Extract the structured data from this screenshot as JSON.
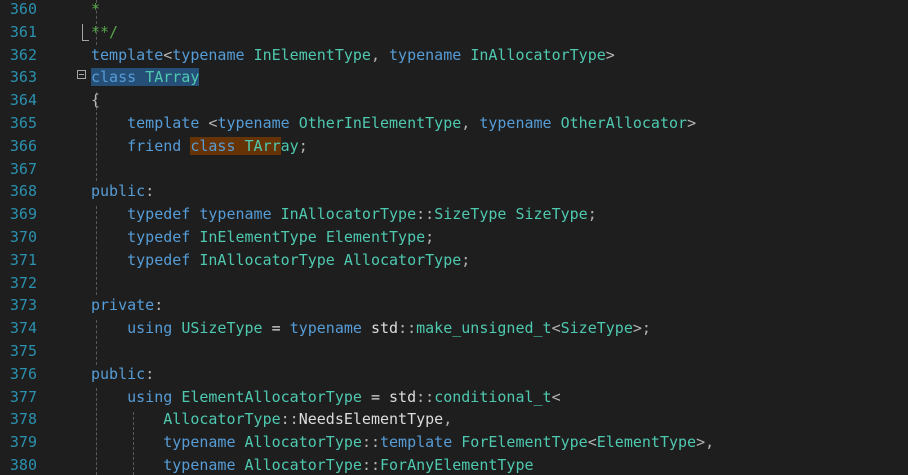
{
  "editor": {
    "lines": [
      {
        "number": "360",
        "tokens": [
          {
            "text": "*",
            "kind": "comment"
          }
        ]
      },
      {
        "number": "361",
        "tokens": [
          {
            "text": "**/",
            "kind": "comment"
          }
        ]
      },
      {
        "number": "362",
        "tokens": [
          {
            "text": "template",
            "kind": "kw"
          },
          {
            "text": "<",
            "kind": "punct"
          },
          {
            "text": "typename",
            "kind": "kw"
          },
          {
            "text": " ",
            "kind": "plain"
          },
          {
            "text": "InElementType",
            "kind": "type"
          },
          {
            "text": ", ",
            "kind": "punct"
          },
          {
            "text": "typename",
            "kind": "kw"
          },
          {
            "text": " ",
            "kind": "plain"
          },
          {
            "text": "InAllocatorType",
            "kind": "type"
          },
          {
            "text": ">",
            "kind": "punct"
          }
        ]
      },
      {
        "number": "363",
        "tokens": [
          {
            "text": "class",
            "kind": "kw",
            "hl": "sel"
          },
          {
            "text": " ",
            "kind": "plain",
            "hl": "sel"
          },
          {
            "text": "TArray",
            "kind": "type",
            "hl": "sel"
          }
        ]
      },
      {
        "number": "364",
        "tokens": [
          {
            "text": "{",
            "kind": "punct"
          }
        ]
      },
      {
        "number": "365",
        "tokens": [
          {
            "text": "    ",
            "kind": "plain"
          },
          {
            "text": "template",
            "kind": "kw"
          },
          {
            "text": " <",
            "kind": "punct"
          },
          {
            "text": "typename",
            "kind": "kw"
          },
          {
            "text": " ",
            "kind": "plain"
          },
          {
            "text": "OtherInElementType",
            "kind": "type"
          },
          {
            "text": ", ",
            "kind": "punct"
          },
          {
            "text": "typename",
            "kind": "kw"
          },
          {
            "text": " ",
            "kind": "plain"
          },
          {
            "text": "OtherAllocator",
            "kind": "type"
          },
          {
            "text": ">",
            "kind": "punct"
          }
        ]
      },
      {
        "number": "366",
        "tokens": [
          {
            "text": "    ",
            "kind": "plain"
          },
          {
            "text": "friend",
            "kind": "kw"
          },
          {
            "text": " ",
            "kind": "plain"
          },
          {
            "text": "class",
            "kind": "kw",
            "hl": "ref"
          },
          {
            "text": " ",
            "kind": "plain",
            "hl": "ref"
          },
          {
            "text": "TArr",
            "kind": "type",
            "hl": "ref"
          },
          {
            "text": "ay",
            "kind": "type"
          },
          {
            "text": ";",
            "kind": "punct"
          }
        ]
      },
      {
        "number": "367",
        "tokens": []
      },
      {
        "number": "368",
        "tokens": [
          {
            "text": "public",
            "kind": "kw"
          },
          {
            "text": ":",
            "kind": "punct"
          }
        ]
      },
      {
        "number": "369",
        "tokens": [
          {
            "text": "    ",
            "kind": "plain"
          },
          {
            "text": "typedef",
            "kind": "kw"
          },
          {
            "text": " ",
            "kind": "plain"
          },
          {
            "text": "typename",
            "kind": "kw"
          },
          {
            "text": " ",
            "kind": "plain"
          },
          {
            "text": "InAllocatorType",
            "kind": "type"
          },
          {
            "text": "::",
            "kind": "punct"
          },
          {
            "text": "SizeType",
            "kind": "type"
          },
          {
            "text": " ",
            "kind": "plain"
          },
          {
            "text": "SizeType",
            "kind": "type"
          },
          {
            "text": ";",
            "kind": "punct"
          }
        ]
      },
      {
        "number": "370",
        "tokens": [
          {
            "text": "    ",
            "kind": "plain"
          },
          {
            "text": "typedef",
            "kind": "kw"
          },
          {
            "text": " ",
            "kind": "plain"
          },
          {
            "text": "InElementType",
            "kind": "type"
          },
          {
            "text": " ",
            "kind": "plain"
          },
          {
            "text": "ElementType",
            "kind": "type"
          },
          {
            "text": ";",
            "kind": "punct"
          }
        ]
      },
      {
        "number": "371",
        "tokens": [
          {
            "text": "    ",
            "kind": "plain"
          },
          {
            "text": "typedef",
            "kind": "kw"
          },
          {
            "text": " ",
            "kind": "plain"
          },
          {
            "text": "InAllocatorType",
            "kind": "type"
          },
          {
            "text": " ",
            "kind": "plain"
          },
          {
            "text": "AllocatorType",
            "kind": "type"
          },
          {
            "text": ";",
            "kind": "punct"
          }
        ]
      },
      {
        "number": "372",
        "tokens": []
      },
      {
        "number": "373",
        "tokens": [
          {
            "text": "private",
            "kind": "kw"
          },
          {
            "text": ":",
            "kind": "punct"
          }
        ]
      },
      {
        "number": "374",
        "tokens": [
          {
            "text": "    ",
            "kind": "plain"
          },
          {
            "text": "using",
            "kind": "kw"
          },
          {
            "text": " ",
            "kind": "plain"
          },
          {
            "text": "USizeType",
            "kind": "type"
          },
          {
            "text": " = ",
            "kind": "plain"
          },
          {
            "text": "typename",
            "kind": "kw"
          },
          {
            "text": " std",
            "kind": "plain"
          },
          {
            "text": "::",
            "kind": "punct"
          },
          {
            "text": "make_unsigned_t",
            "kind": "type"
          },
          {
            "text": "<",
            "kind": "punct"
          },
          {
            "text": "SizeType",
            "kind": "type"
          },
          {
            "text": ">;",
            "kind": "punct"
          }
        ]
      },
      {
        "number": "375",
        "tokens": []
      },
      {
        "number": "376",
        "tokens": [
          {
            "text": "public",
            "kind": "kw"
          },
          {
            "text": ":",
            "kind": "punct"
          }
        ]
      },
      {
        "number": "377",
        "tokens": [
          {
            "text": "    ",
            "kind": "plain"
          },
          {
            "text": "using",
            "kind": "kw"
          },
          {
            "text": " ",
            "kind": "plain"
          },
          {
            "text": "ElementAllocatorType",
            "kind": "type"
          },
          {
            "text": " = ",
            "kind": "plain"
          },
          {
            "text": "std",
            "kind": "plain"
          },
          {
            "text": "::",
            "kind": "punct"
          },
          {
            "text": "conditional_t",
            "kind": "type"
          },
          {
            "text": "<",
            "kind": "punct"
          }
        ]
      },
      {
        "number": "378",
        "tokens": [
          {
            "text": "        ",
            "kind": "plain"
          },
          {
            "text": "AllocatorType",
            "kind": "type"
          },
          {
            "text": "::",
            "kind": "punct"
          },
          {
            "text": "NeedsElementType",
            "kind": "plain"
          },
          {
            "text": ",",
            "kind": "punct"
          }
        ]
      },
      {
        "number": "379",
        "tokens": [
          {
            "text": "        ",
            "kind": "plain"
          },
          {
            "text": "typename",
            "kind": "kw"
          },
          {
            "text": " ",
            "kind": "plain"
          },
          {
            "text": "AllocatorType",
            "kind": "type"
          },
          {
            "text": "::",
            "kind": "punct"
          },
          {
            "text": "template",
            "kind": "kw"
          },
          {
            "text": " ",
            "kind": "plain"
          },
          {
            "text": "ForElementType",
            "kind": "type"
          },
          {
            "text": "<",
            "kind": "punct"
          },
          {
            "text": "ElementType",
            "kind": "type"
          },
          {
            "text": ">,",
            "kind": "punct"
          }
        ]
      },
      {
        "number": "380",
        "tokens": [
          {
            "text": "        ",
            "kind": "plain"
          },
          {
            "text": "typename",
            "kind": "kw"
          },
          {
            "text": " ",
            "kind": "plain"
          },
          {
            "text": "AllocatorType",
            "kind": "type"
          },
          {
            "text": "::",
            "kind": "punct"
          },
          {
            "text": "ForAnyElementType",
            "kind": "type"
          }
        ]
      }
    ]
  },
  "colors": {
    "background": "#1e1e1e",
    "line_number": "#2b91af",
    "keyword": "#569cd6",
    "type": "#4ec9b0",
    "comment": "#57a64a",
    "selection_highlight": "#264f78",
    "reference_highlight": "#653306"
  },
  "icons": {
    "fold": "collapse-minus-icon"
  }
}
